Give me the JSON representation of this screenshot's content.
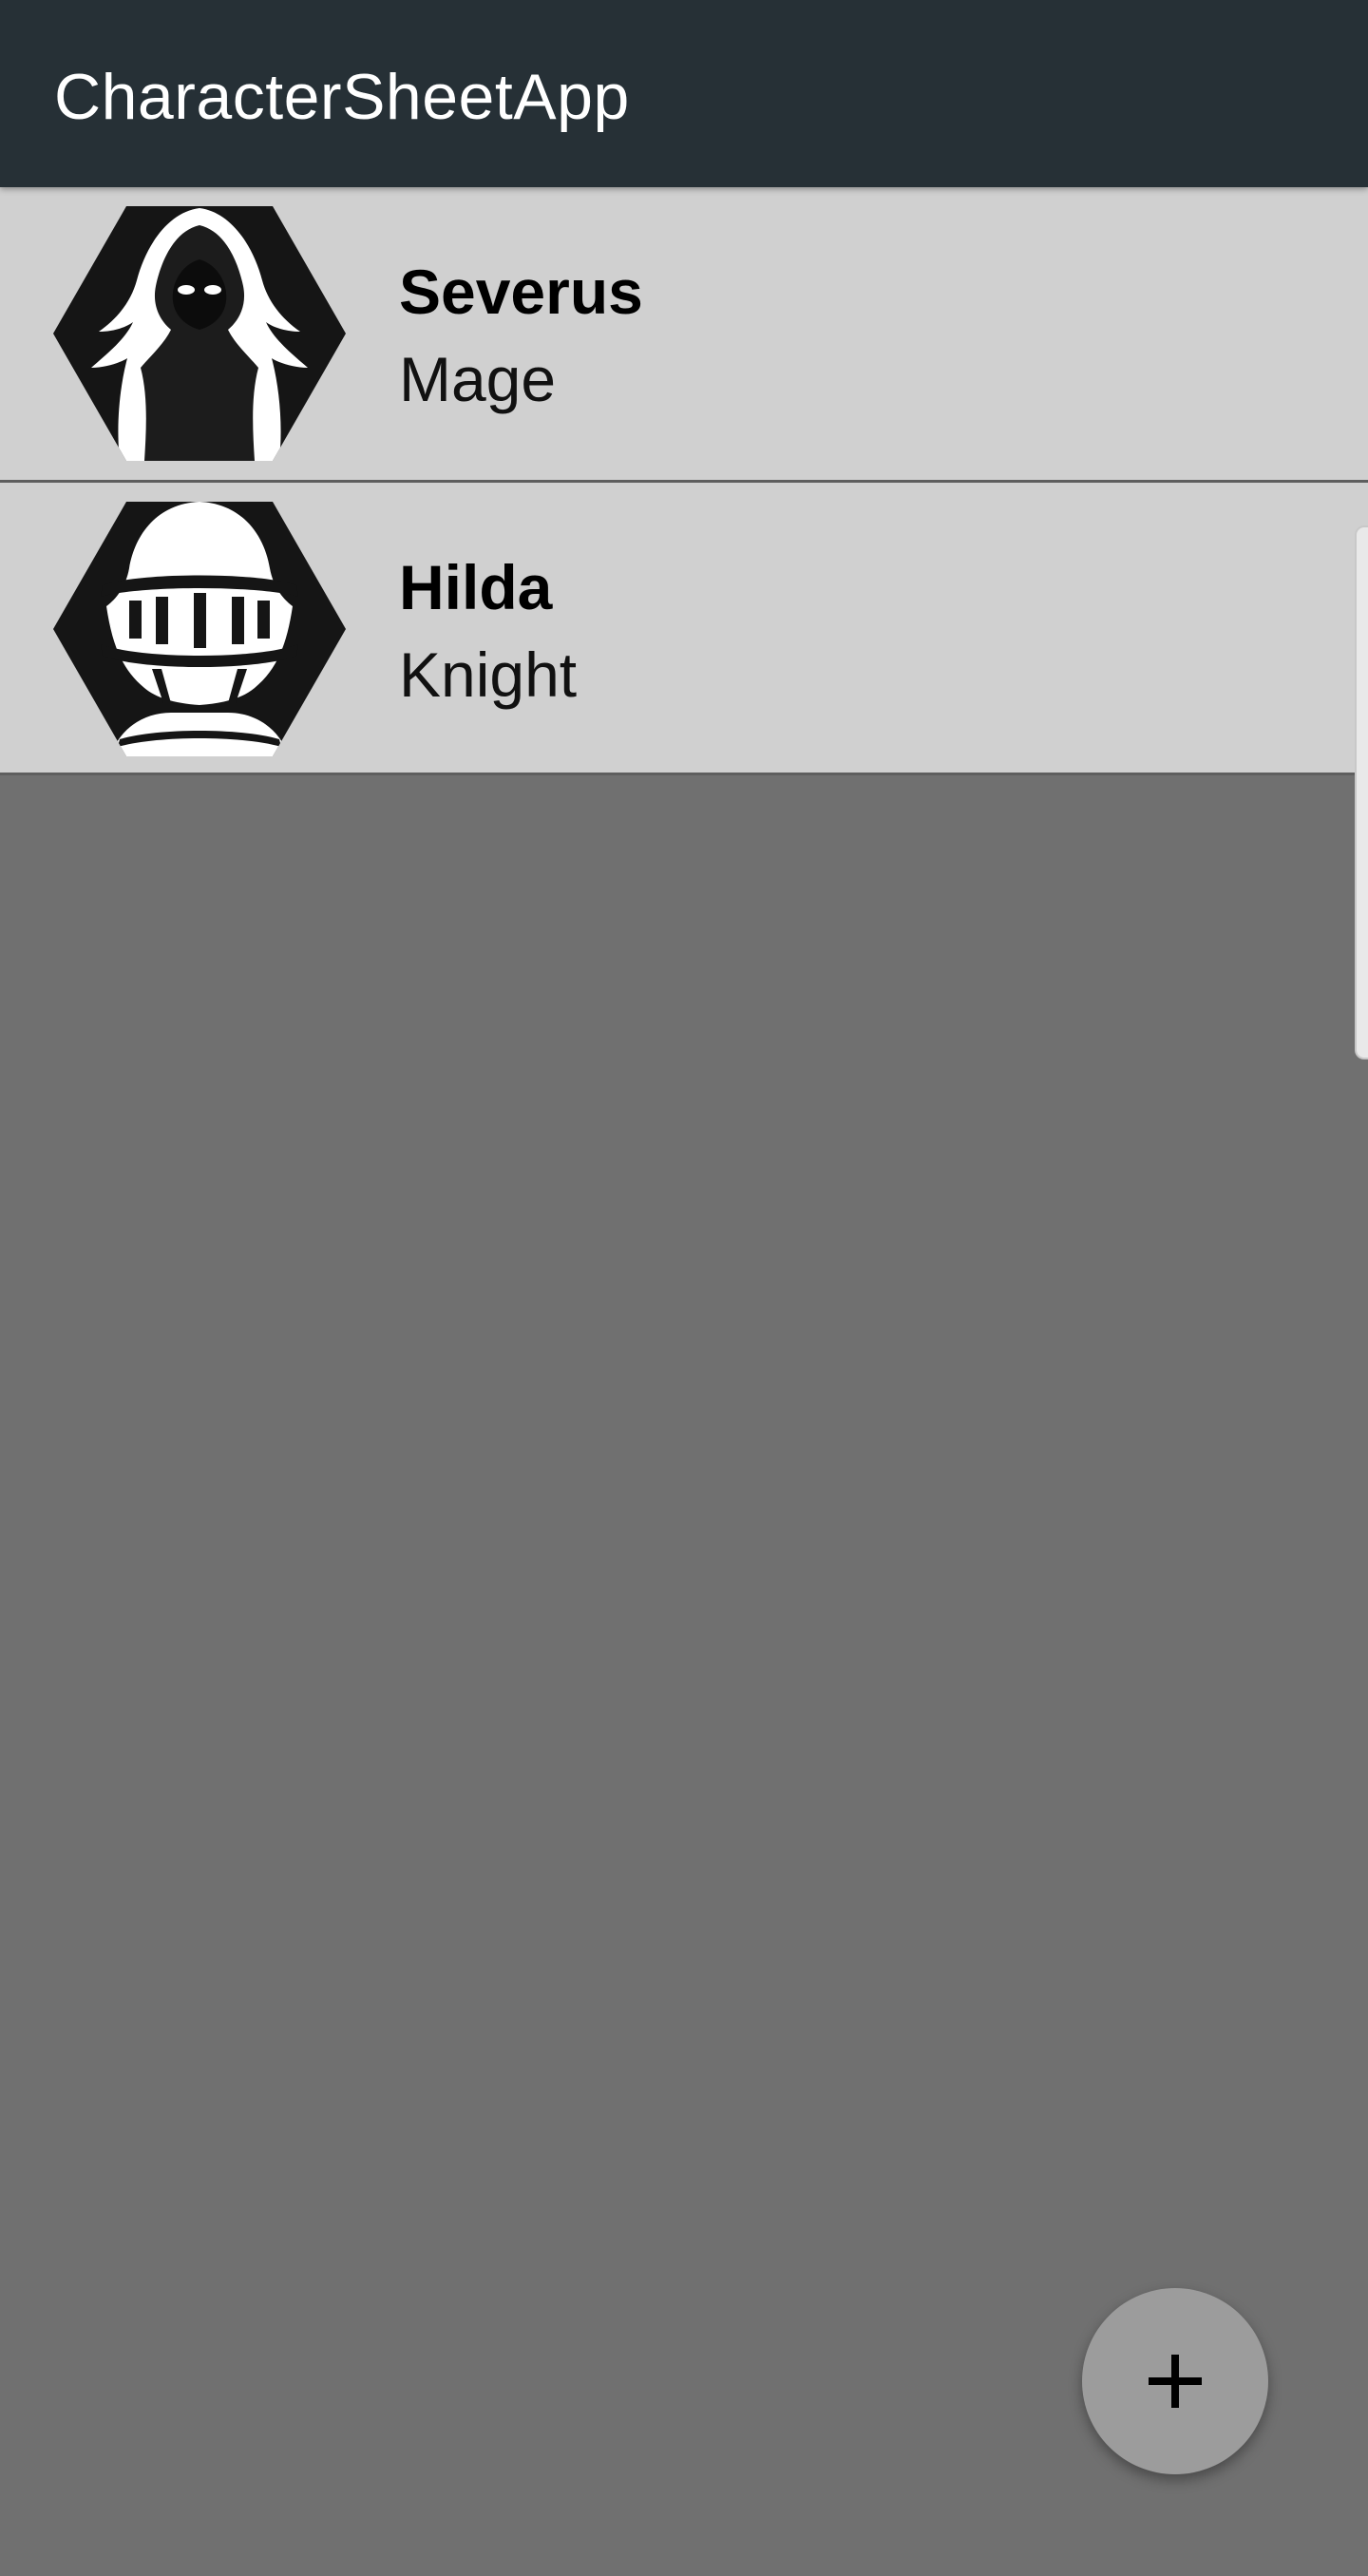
{
  "app_bar": {
    "title": "CharacterSheetApp"
  },
  "characters": [
    {
      "name": "Severus",
      "class": "Mage",
      "avatar_icon": "hooded-mage-icon"
    },
    {
      "name": "Hilda",
      "class": "Knight",
      "avatar_icon": "knight-helmet-icon"
    }
  ],
  "fab": {
    "icon": "plus-icon"
  },
  "colors": {
    "app_bar": "#263036",
    "list_item_bg": "#d0d0d0",
    "page_bg": "#707070",
    "fab_bg": "#9c9c9c"
  }
}
